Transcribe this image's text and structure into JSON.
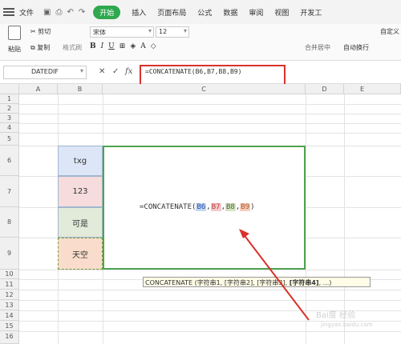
{
  "menubar": {
    "file_label": "文件",
    "start_label": "开始",
    "tabs": [
      "插入",
      "页面布局",
      "公式",
      "数据",
      "审阅",
      "视图",
      "开发工"
    ]
  },
  "ribbon": {
    "paste_label": "粘贴",
    "cut_label": "剪切",
    "copy_label": "复制",
    "format_painter_label": "格式刷",
    "font_name": "宋体",
    "font_size": "12",
    "merge_label": "合并居中",
    "wrap_label": "自动换行",
    "custom_label": "自定义"
  },
  "formula_bar": {
    "name_box": "DATEDIF",
    "fx_label": "fx",
    "formula": "=CONCATENATE(B6,B7,B8,B9)"
  },
  "columns": [
    "A",
    "B",
    "C",
    "D",
    "E"
  ],
  "rows": [
    "1",
    "2",
    "3",
    "4",
    "5",
    "6",
    "7",
    "8",
    "9",
    "10",
    "11",
    "12",
    "13",
    "14",
    "15",
    "16"
  ],
  "cells": {
    "b6": "txg",
    "b7": "123",
    "b8": "可是",
    "b9": "天空"
  },
  "edit_cell": {
    "prefix": "=CONCATENATE(",
    "ref1": "B6",
    "ref2": "B7",
    "ref3": "B8",
    "ref4": "B9",
    "sep": ",",
    "suffix": ")"
  },
  "tooltip": {
    "text": "CONCATENATE (字符串1, [字符串2], [字符串3], ",
    "bold": "[字符串4]",
    "tail": ", ...)"
  },
  "watermark": {
    "text": "Bai度 经验",
    "sub": "jingyan.baidu.com"
  },
  "colors": {
    "accent_green": "#2fa84f",
    "annotation_red": "#d9312a"
  }
}
